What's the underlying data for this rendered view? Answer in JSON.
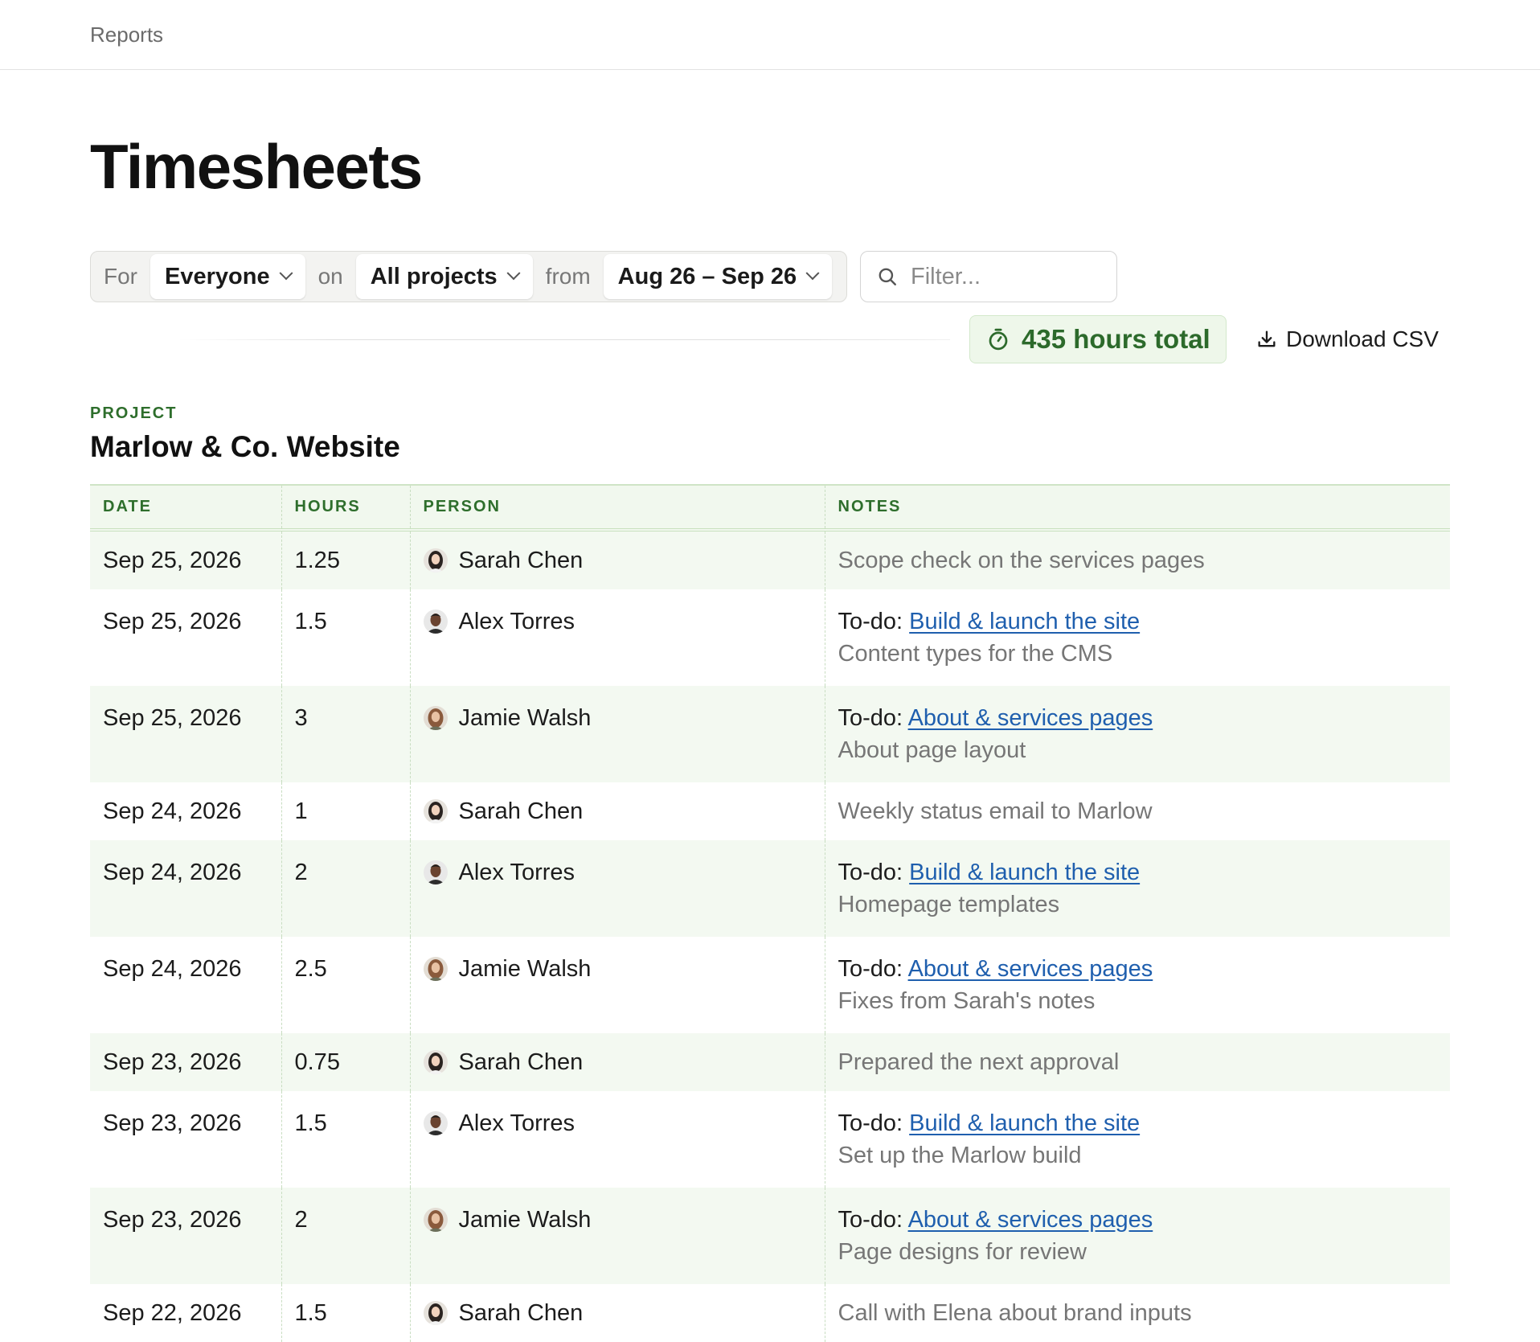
{
  "topbar": {
    "breadcrumb": "Reports"
  },
  "page": {
    "title": "Timesheets"
  },
  "filters": {
    "for_label": "For",
    "person": "Everyone",
    "on_label": "on",
    "project": "All projects",
    "from_label": "from",
    "date_range": "Aug 26 – Sep 26",
    "search_placeholder": "Filter..."
  },
  "summary": {
    "total_label": "435 hours total",
    "download_label": "Download CSV"
  },
  "project": {
    "label": "PROJECT",
    "name": "Marlow & Co. Website"
  },
  "table": {
    "headers": {
      "date": "DATE",
      "hours": "HOURS",
      "person": "PERSON",
      "notes": "NOTES"
    },
    "rows": [
      {
        "date": "Sep 25, 2026",
        "hours": "1.25",
        "person": "Sarah Chen",
        "avatar": "sarah",
        "note": "Scope check on the services pages"
      },
      {
        "date": "Sep 25, 2026",
        "hours": "1.5",
        "person": "Alex Torres",
        "avatar": "alex",
        "todo_prefix": "To-do:",
        "todo": "Build & launch the site",
        "note": "Content types for the CMS"
      },
      {
        "date": "Sep 25, 2026",
        "hours": "3",
        "person": "Jamie Walsh",
        "avatar": "jamie",
        "todo_prefix": "To-do:",
        "todo": "About & services pages",
        "note": "About page layout"
      },
      {
        "date": "Sep 24, 2026",
        "hours": "1",
        "person": "Sarah Chen",
        "avatar": "sarah",
        "note": "Weekly status email to Marlow"
      },
      {
        "date": "Sep 24, 2026",
        "hours": "2",
        "person": "Alex Torres",
        "avatar": "alex",
        "todo_prefix": "To-do:",
        "todo": "Build & launch the site",
        "note": "Homepage templates"
      },
      {
        "date": "Sep 24, 2026",
        "hours": "2.5",
        "person": "Jamie Walsh",
        "avatar": "jamie",
        "todo_prefix": "To-do:",
        "todo": "About & services pages",
        "note": "Fixes from Sarah's notes"
      },
      {
        "date": "Sep 23, 2026",
        "hours": "0.75",
        "person": "Sarah Chen",
        "avatar": "sarah",
        "note": "Prepared the next approval"
      },
      {
        "date": "Sep 23, 2026",
        "hours": "1.5",
        "person": "Alex Torres",
        "avatar": "alex",
        "todo_prefix": "To-do:",
        "todo": "Build & launch the site",
        "note": "Set up the Marlow build"
      },
      {
        "date": "Sep 23, 2026",
        "hours": "2",
        "person": "Jamie Walsh",
        "avatar": "jamie",
        "todo_prefix": "To-do:",
        "todo": "About & services pages",
        "note": "Page designs for review"
      },
      {
        "date": "Sep 22, 2026",
        "hours": "1.5",
        "person": "Sarah Chen",
        "avatar": "sarah",
        "note": "Call with Elena about brand inputs"
      }
    ]
  }
}
